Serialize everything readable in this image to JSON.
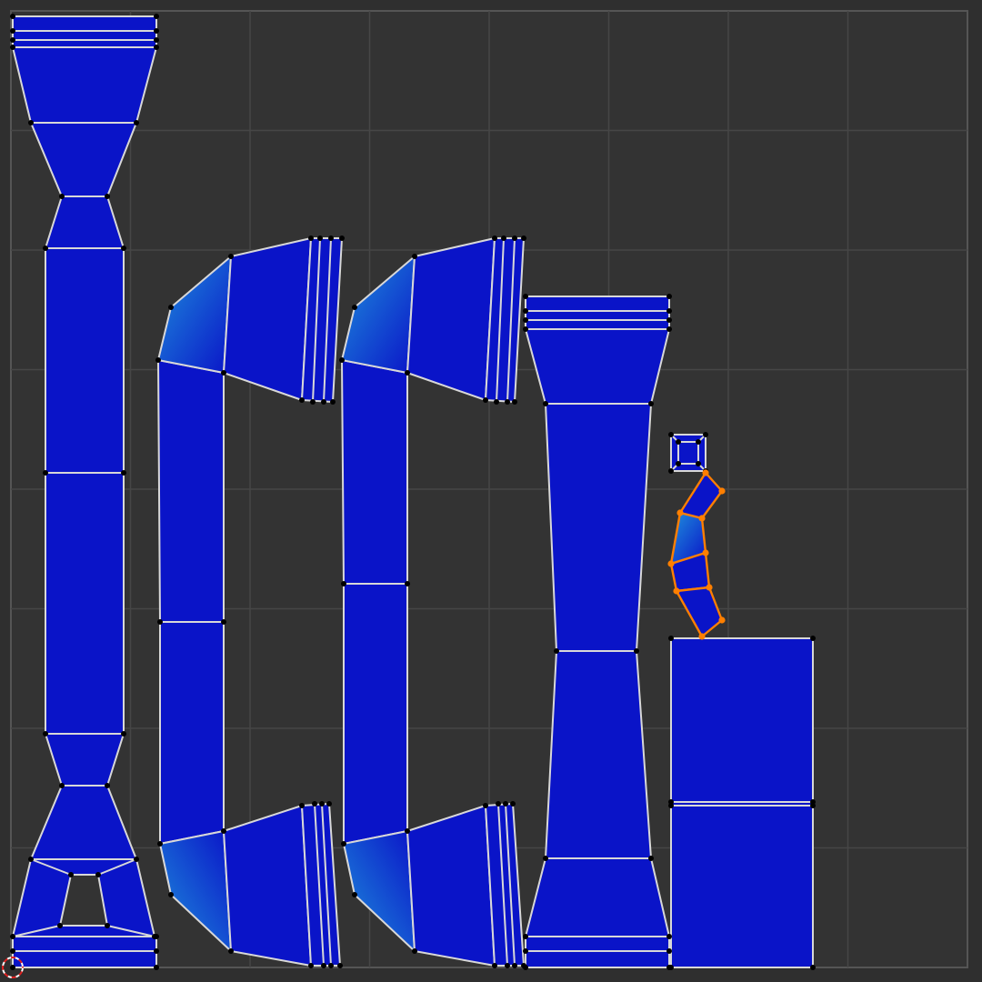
{
  "editor": {
    "name": "UV Editor",
    "background_color": "#2f2f2f",
    "canvas_color": "#333333",
    "grid_line_color": "#464646",
    "grid_border_color": "#555555",
    "face_fill_color": "#0a14c8",
    "face_highlight_color": "#1e8fdc",
    "edge_color": "#d8d8d8",
    "vertex_color": "#000000",
    "selected_color": "#ff7f00",
    "cursor_icon": "2d-cursor-icon",
    "vertex_icon": "vertex-dot-icon"
  },
  "uv_islands": [
    {
      "id": "left-column",
      "selected": false
    },
    {
      "id": "bent-tube-1",
      "selected": false
    },
    {
      "id": "bent-tube-2",
      "selected": false
    },
    {
      "id": "tapered-column",
      "selected": false
    },
    {
      "id": "small-square",
      "selected": false
    },
    {
      "id": "curved-strip",
      "selected": true
    },
    {
      "id": "rectangle-block",
      "selected": false
    }
  ]
}
